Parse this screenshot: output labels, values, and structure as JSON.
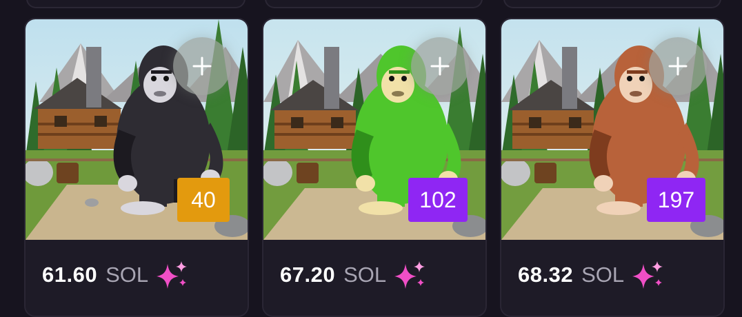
{
  "cards": [
    {
      "fur_color": "#2e2c33",
      "fur_shade": "#1c1a20",
      "face_color": "#d9d7de",
      "rank": "40",
      "rank_color": "#e39a0e",
      "price": "61.60",
      "unit": "SOL",
      "icons": {
        "plus": "plus-icon",
        "sparkle": "sparkles-icon"
      }
    },
    {
      "fur_color": "#4fc62c",
      "fur_shade": "#2f8f1b",
      "face_color": "#f1e1a8",
      "rank": "102",
      "rank_color": "#8f26f3",
      "price": "67.20",
      "unit": "SOL",
      "icons": {
        "plus": "plus-icon",
        "sparkle": "sparkles-icon"
      }
    },
    {
      "fur_color": "#b8623a",
      "fur_shade": "#7e3c1e",
      "face_color": "#f0d2b8",
      "rank": "197",
      "rank_color": "#8f26f3",
      "price": "68.32",
      "unit": "SOL",
      "icons": {
        "plus": "plus-icon",
        "sparkle": "sparkles-icon"
      }
    }
  ],
  "accent": {
    "sparkle_pink": "#f04fc6",
    "sparkle_light": "#ff9ee2"
  }
}
